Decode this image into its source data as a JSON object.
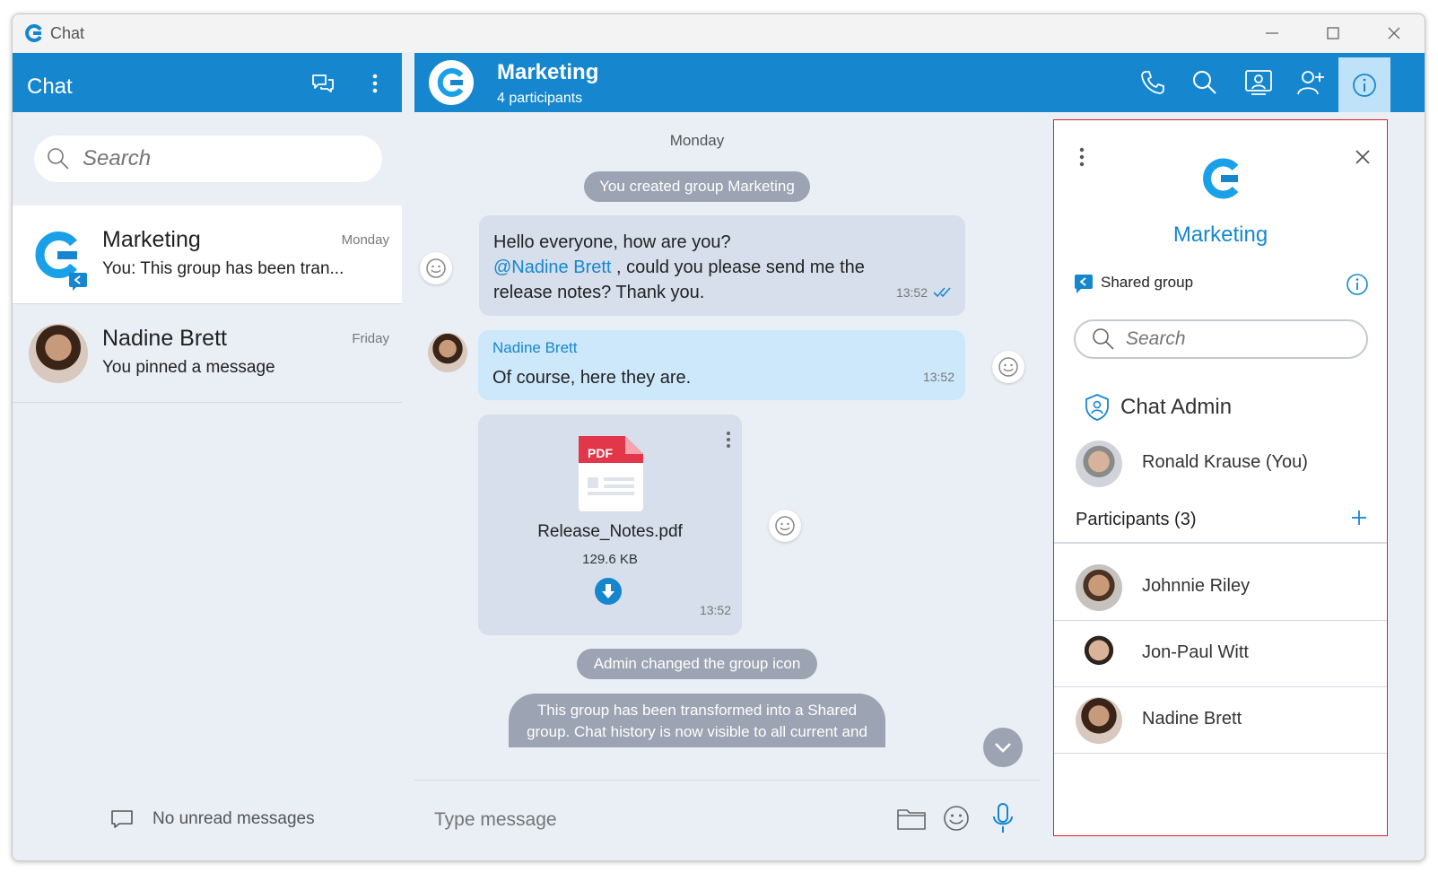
{
  "window": {
    "title": "Chat"
  },
  "left": {
    "title": "Chat",
    "search_placeholder": "Search",
    "conversations": [
      {
        "name": "Marketing",
        "time": "Monday",
        "preview": "You: This group has been tran..."
      },
      {
        "name": "Nadine Brett",
        "time": "Friday",
        "preview": "You pinned a message"
      }
    ],
    "no_unread": "No unread messages"
  },
  "header": {
    "name": "Marketing",
    "subtitle": "4 participants"
  },
  "messages": {
    "day": "Monday",
    "sys_created": "You created group Marketing",
    "msg1": {
      "line1": "Hello everyone, how are you?",
      "mention": "@Nadine Brett",
      "line2_rest": " , could you please send me the",
      "line3": "release notes? Thank you.",
      "time": "13:52"
    },
    "msg2": {
      "sender": "Nadine Brett",
      "text": "Of course, here they are.",
      "time": "13:52"
    },
    "file": {
      "badge": "PDF",
      "name": "Release_Notes.pdf",
      "size": "129.6 KB",
      "time": "13:52"
    },
    "sys_icon": "Admin changed the group icon",
    "sys_shared_line1": "This group has been transformed into a Shared",
    "sys_shared_line2": "group. Chat history is now visible to all current and"
  },
  "composer": {
    "placeholder": "Type message"
  },
  "panel": {
    "name": "Marketing",
    "shared_label": "Shared group",
    "search_placeholder": "Search",
    "admin_section": "Chat Admin",
    "admin": "Ronald Krause (You)",
    "participants_header": "Participants (3)",
    "participants": [
      "Johnnie Riley",
      "Jon-Paul Witt",
      "Nadine Brett"
    ]
  },
  "colors": {
    "brand": "#1687cf",
    "active_tab": "#bfe2f8",
    "bubble_out": "#d6dfeb",
    "bubble_in": "#cde8fb",
    "system_pill": "#9ca3b2",
    "highlight_border": "#e02020",
    "pdf_red": "#e2374a"
  }
}
